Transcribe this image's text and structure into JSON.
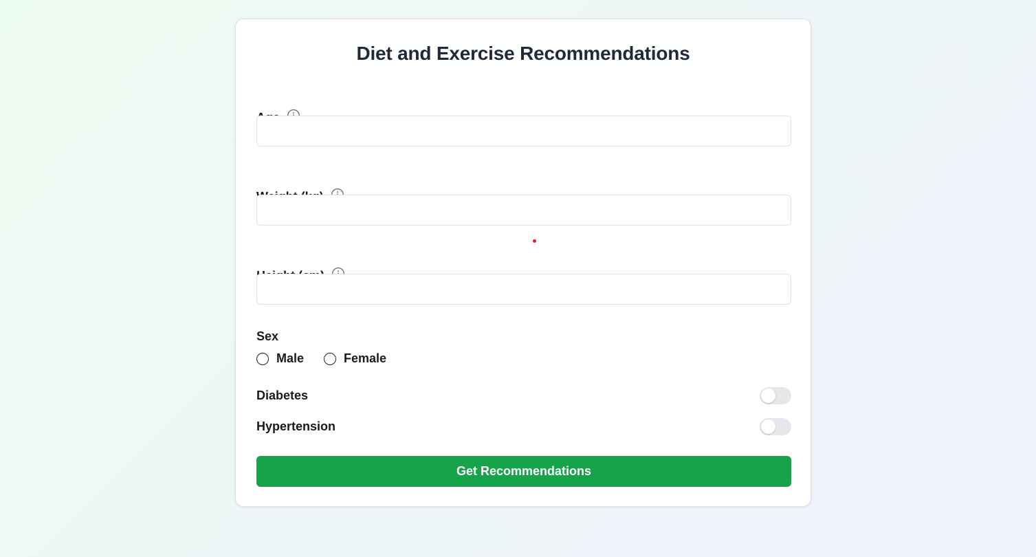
{
  "form": {
    "title": "Diet and Exercise Recommendations",
    "fields": {
      "age": {
        "label": "Age",
        "value": "",
        "icon": "info-icon"
      },
      "weight": {
        "label": "Weight (kg)",
        "value": "",
        "icon": "info-icon"
      },
      "height": {
        "label": "Height (cm)",
        "value": "",
        "icon": "info-icon"
      }
    },
    "sex": {
      "label": "Sex",
      "options": [
        "Male",
        "Female"
      ],
      "selected": null
    },
    "toggles": {
      "diabetes": {
        "label": "Diabetes",
        "on": false
      },
      "hypertension": {
        "label": "Hypertension",
        "on": false
      }
    },
    "submit_label": "Get Recommendations"
  },
  "colors": {
    "accent": "#16a34a",
    "toggle_off": "#e5e7eb",
    "title_text": "#1f2937"
  }
}
